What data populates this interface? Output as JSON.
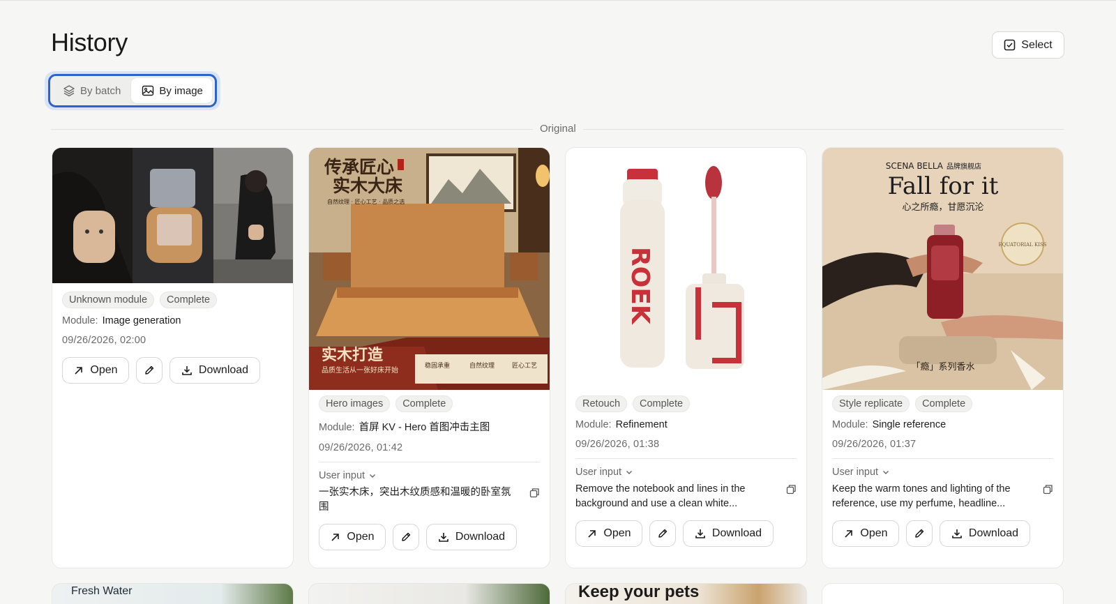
{
  "page": {
    "title": "History"
  },
  "toolbar": {
    "select_label": "Select"
  },
  "view_toggle": {
    "by_batch": "By batch",
    "by_image": "By image"
  },
  "section": {
    "label": "Original"
  },
  "labels": {
    "module": "Module:",
    "user_input": "User input"
  },
  "cards": [
    {
      "tags": [
        "Unknown module",
        "Complete"
      ],
      "module": "Image generation",
      "date": "09/26/2026, 02:00",
      "open": "Open",
      "download": "Download"
    },
    {
      "tags": [
        "Hero images",
        "Complete"
      ],
      "module": "首屏 KV - Hero 首图冲击主图",
      "date": "09/26/2026, 01:42",
      "prompt": "一张实木床，突出木纹质感和温暖的卧室氛围",
      "open": "Open",
      "download": "Download",
      "image_text": {
        "headline": "传承匠心",
        "headline2": "实木大床",
        "sub": "自然纹理 · 匠心工艺 · 品质之选",
        "banner_title": "实木打造",
        "banner_sub": "品质生活从一张好床开始",
        "badge1": "稳固承重",
        "badge2": "自然纹理",
        "badge3": "匠心工艺"
      }
    },
    {
      "tags": [
        "Retouch",
        "Complete"
      ],
      "module": "Refinement",
      "date": "09/26/2026, 01:38",
      "prompt": "Remove the notebook and lines in the background and use a clean white...",
      "open": "Open",
      "download": "Download",
      "image_text": {
        "brand": "ROEK"
      }
    },
    {
      "tags": [
        "Style replicate",
        "Complete"
      ],
      "module": "Single reference",
      "date": "09/26/2026, 01:37",
      "prompt": "Keep the warm tones and lighting of the reference, use my perfume, headline...",
      "open": "Open",
      "download": "Download",
      "image_text": {
        "brand": "SCENA BELLA",
        "store": "品牌旗舰店",
        "headline": "Fall for it",
        "sub": "心之所瘾，甘愿沉沦",
        "seal": "EQUATORIAL KISS",
        "caption": "「瘾」系列香水"
      }
    }
  ],
  "bottom_cards": [
    {
      "text": "Fresh Water"
    },
    {
      "text": ""
    },
    {
      "text": "Keep your pets"
    },
    {
      "text": ""
    }
  ],
  "colors": {
    "accent": "#2a63cc",
    "background": "#f6f6f5"
  }
}
